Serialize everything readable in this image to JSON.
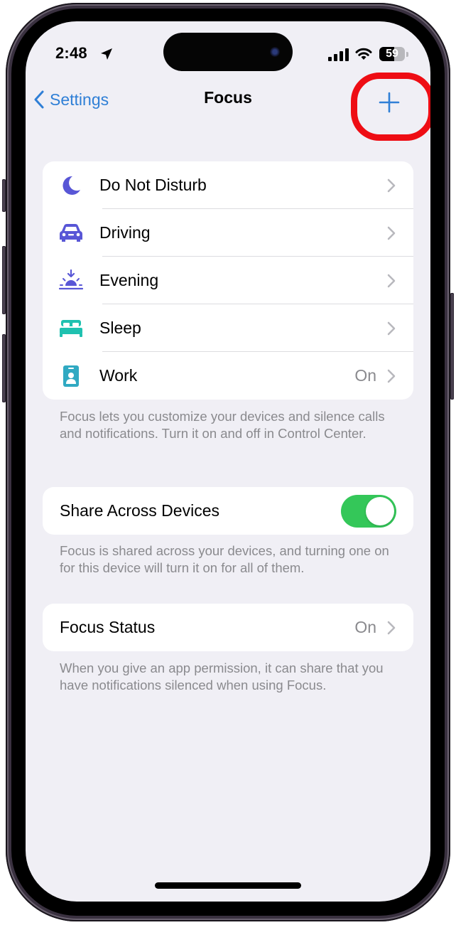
{
  "status_bar": {
    "time": "2:48",
    "battery_percent": "59",
    "battery_level": 0.59,
    "icons": [
      "location-arrow-icon",
      "cellular-signal-icon",
      "wifi-icon",
      "battery-icon"
    ]
  },
  "nav": {
    "back_label": "Settings",
    "title": "Focus",
    "add_icon": "plus-icon",
    "accent_color": "#2f7fd6"
  },
  "annotation": {
    "type": "highlight-ring",
    "target": "add-focus-button",
    "color": "#ee0d14"
  },
  "focus_modes": [
    {
      "label": "Do Not Disturb",
      "icon": "moon-icon",
      "color": "#5856d6",
      "value": ""
    },
    {
      "label": "Driving",
      "icon": "car-icon",
      "color": "#5856d6",
      "value": ""
    },
    {
      "label": "Evening",
      "icon": "sunset-icon",
      "color": "#5856d6",
      "value": ""
    },
    {
      "label": "Sleep",
      "icon": "bed-icon",
      "color": "#1fc1b0",
      "value": ""
    },
    {
      "label": "Work",
      "icon": "id-badge-icon",
      "color": "#30a9c2",
      "value": "On"
    }
  ],
  "focus_modes_footer": "Focus lets you customize your devices and silence calls and notifications. Turn it on and off in Control Center.",
  "share_across_devices": {
    "label": "Share Across Devices",
    "enabled": true,
    "toggle_color": "#34c759",
    "footer": "Focus is shared across your devices, and turning one on for this device will turn it on for all of them."
  },
  "focus_status": {
    "label": "Focus Status",
    "value": "On",
    "footer": "When you give an app permission, it can share that you have notifications silenced when using Focus."
  }
}
